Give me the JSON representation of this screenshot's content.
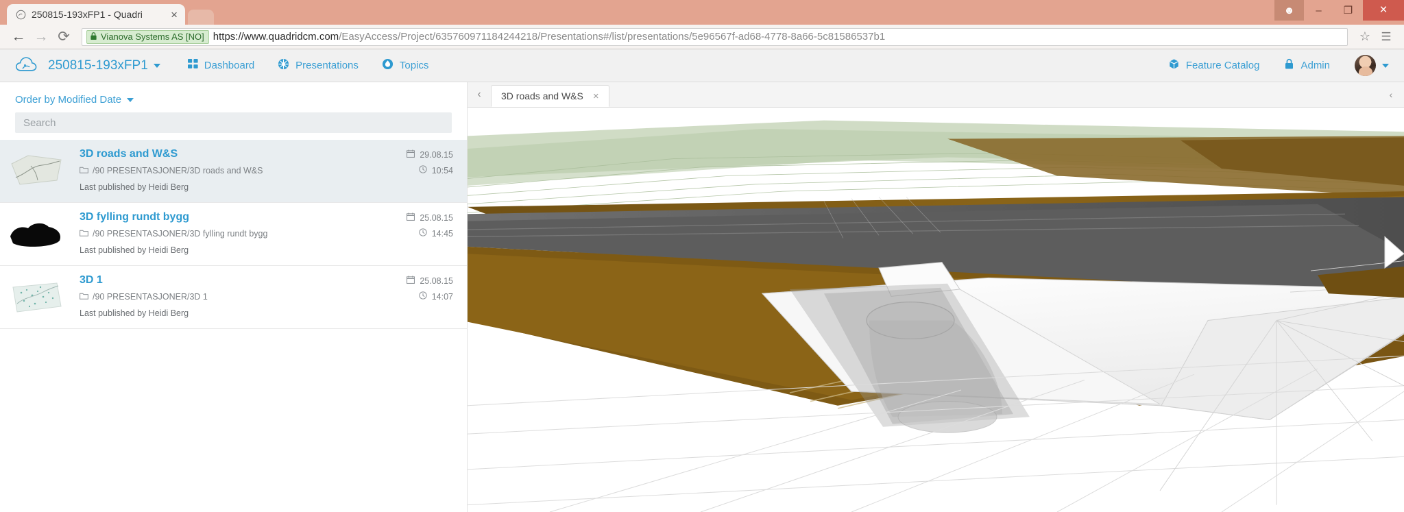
{
  "browser": {
    "tab_title": "250815-193xFP1 - Quadri",
    "tab_close_glyph": "×",
    "new_tab_name": "new-tab-button",
    "back_glyph": "←",
    "forward_glyph": "→",
    "reload_glyph": "⟳",
    "security_org": "Vianova Systems AS [NO]",
    "lock_glyph": "🔒",
    "url_domain": "https://www.quadridcm.com",
    "url_path": "/EasyAccess/Project/635760971184244218/Presentations#/list/presentations/5e96567f-ad68-4778-8a66-5c81586537b1",
    "bookmark_glyph": "☆",
    "menu_glyph": "☰",
    "win_person_glyph": "☻",
    "win_minimize_glyph": "–",
    "win_restore_glyph": "❐",
    "win_close_glyph": "×"
  },
  "appheader": {
    "logo_icon": "quadri-cloud-logo-icon",
    "project_name": "250815-193xFP1",
    "nav": [
      {
        "label": "Dashboard",
        "icon": "grid-icon"
      },
      {
        "label": "Presentations",
        "icon": "presentation-globe-icon"
      },
      {
        "label": "Topics",
        "icon": "topics-drop-icon"
      }
    ],
    "right_nav": [
      {
        "label": "Feature Catalog",
        "icon": "cube-box-icon"
      },
      {
        "label": "Admin",
        "icon": "lock-icon"
      }
    ],
    "avatar_name": "user-avatar",
    "accent_color": "#2e9ad0"
  },
  "sidebar": {
    "order_by_label": "Order by Modified Date",
    "search_placeholder": "Search",
    "search_value": "",
    "calendar_icon": "calendar-icon",
    "clock_icon": "clock-icon",
    "folder_icon": "folder-icon",
    "items": [
      {
        "title": "3D roads and W&S",
        "path": "/90 PRESENTASJONER/3D roads and W&S",
        "published_by": "Last published by Heidi Berg",
        "date": "29.08.15",
        "time": "10:54",
        "selected": true,
        "thumb": "terrain-light"
      },
      {
        "title": "3D fylling rundt bygg",
        "path": "/90 PRESENTASJONER/3D fylling rundt bygg",
        "published_by": "Last published by Heidi Berg",
        "date": "25.08.15",
        "time": "14:45",
        "selected": false,
        "thumb": "dark-blob"
      },
      {
        "title": "3D 1",
        "path": "/90 PRESENTASJONER/3D 1",
        "published_by": "Last published by Heidi Berg",
        "date": "25.08.15",
        "time": "14:07",
        "selected": false,
        "thumb": "terrain-speckled"
      }
    ]
  },
  "viewer": {
    "prev_arrow_glyph": "‹",
    "tab_label": "3D roads and W&S",
    "tab_close_glyph": "×",
    "collapse_glyph": "‹",
    "scene_name": "3d-road-model-viewport",
    "colors": {
      "road_asphalt": "#5d5d5d",
      "terrain_brown": "#7d5a15",
      "water_green": "#0d7a5f",
      "embankment_white": "#f2f2f2",
      "grass_green": "#cfdcc4"
    }
  }
}
